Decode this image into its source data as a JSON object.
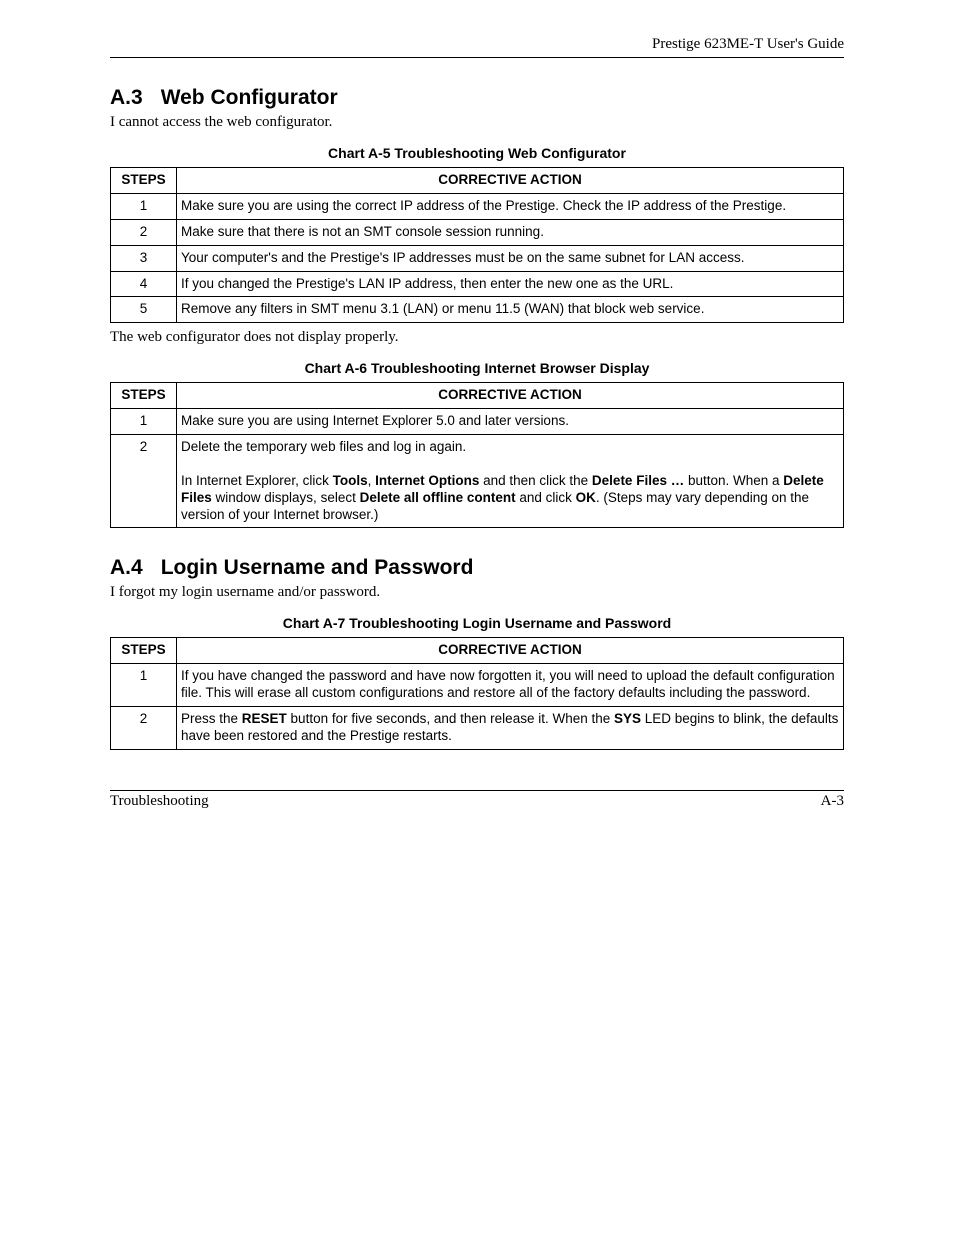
{
  "header": {
    "running_head": "Prestige 623ME-T User's Guide"
  },
  "sections": {
    "a3": {
      "num": "A.3",
      "title": "Web Configurator",
      "intro": "I cannot access the web configurator.",
      "post_note": "The web configurator does not display properly."
    },
    "a4": {
      "num": "A.4",
      "title": "Login Username and Password",
      "intro": "I forgot my login username and/or password."
    }
  },
  "charts": {
    "a5": {
      "title": "Chart A-5 Troubleshooting Web Configurator",
      "col_steps": "STEPS",
      "col_action": "CORRECTIVE ACTION",
      "rows": [
        {
          "step": "1",
          "action_html": "Make sure you are using the correct IP address of the Prestige. Check the IP address of the Prestige."
        },
        {
          "step": "2",
          "action_html": "Make sure that there is not an SMT console session running."
        },
        {
          "step": "3",
          "action_html": "Your computer's and the Prestige's IP addresses must be on the same subnet for LAN access."
        },
        {
          "step": "4",
          "action_html": "If you changed the Prestige's LAN IP address, then enter the new one as the URL."
        },
        {
          "step": "5",
          "action_html": "Remove any filters in SMT menu 3.1 (LAN) or menu 11.5 (WAN) that block web service."
        }
      ]
    },
    "a6": {
      "title": "Chart A-6 Troubleshooting Internet Browser Display",
      "col_steps": "STEPS",
      "col_action": "CORRECTIVE ACTION",
      "rows": [
        {
          "step": "1",
          "action_html": "Make sure you are using Internet Explorer 5.0 and later versions."
        },
        {
          "step": "2",
          "action_html": "Delete the temporary web files and log in again.<br><br>In Internet Explorer, click <b>Tools</b>, <b>Internet Options</b> and then click the <b>Delete Files …</b> button. When a <b>Delete Files</b> window displays, select <b>Delete all offline content</b> and click <b>OK</b>. (Steps may vary depending on the version of your Internet browser.)"
        }
      ]
    },
    "a7": {
      "title": "Chart A-7 Troubleshooting Login Username and Password",
      "col_steps": "STEPS",
      "col_action": "CORRECTIVE ACTION",
      "rows": [
        {
          "step": "1",
          "action_html": "If you have changed the password and have now forgotten it, you will need to upload the default configuration file. This will erase all custom configurations and restore all of the factory defaults including the password."
        },
        {
          "step": "2",
          "action_html": "Press the <b>RESET</b> button for five seconds, and then release it. When the <b>SYS</b> LED begins to blink, the defaults have been restored and the Prestige restarts."
        }
      ]
    }
  },
  "footer": {
    "left": "Troubleshooting",
    "right": "A-3"
  }
}
